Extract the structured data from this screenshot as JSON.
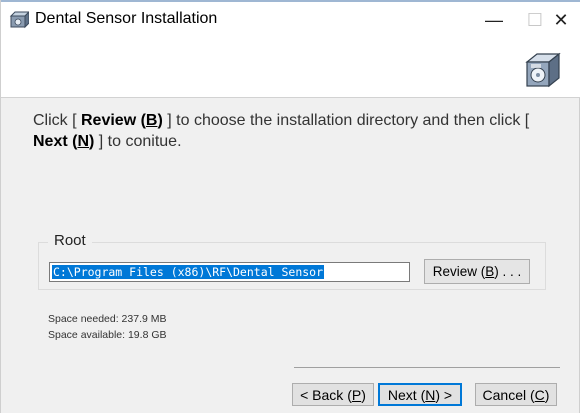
{
  "window": {
    "title": "Dental Sensor Installation",
    "minimize_glyph": "—",
    "maximize_glyph": "☐",
    "close_glyph": "✕"
  },
  "instruction": {
    "part1": "Click [ ",
    "review_word": "Review (",
    "review_key": "B",
    "review_close": ")",
    "part2": " ] to choose the installation directory and then click [ ",
    "next_word": "Next (",
    "next_key": "N",
    "next_close": ")",
    "part3": " ] to conitue."
  },
  "root_group": {
    "label": "Root",
    "path_value": "C:\\Program Files (x86)\\RF\\Dental Sensor",
    "review_button": {
      "text": "Review (",
      "key": "B",
      "suffix": ") . . ."
    }
  },
  "space": {
    "needed": "Space needed: 237.9 MB",
    "available": "Space available: 19.8 GB"
  },
  "buttons": {
    "back": {
      "text": "< Back (",
      "key": "P",
      "suffix": ")"
    },
    "next": {
      "text": "Next  (",
      "key": "N",
      "suffix": ") >"
    },
    "cancel": {
      "text": "Cancel (",
      "key": "C",
      "suffix": ")"
    }
  },
  "icons": {
    "app": "installer-box-icon",
    "header": "installer-box-large-icon"
  },
  "colors": {
    "selection": "#0078d7",
    "background": "#f0f0f0",
    "header": "#ffffff"
  }
}
